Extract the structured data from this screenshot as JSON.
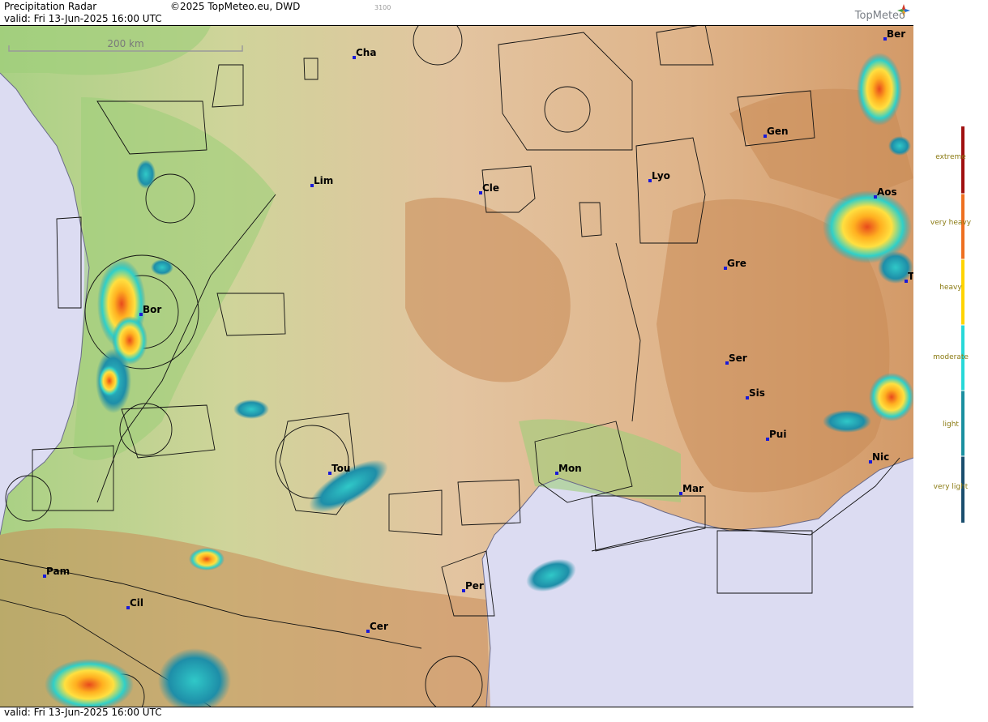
{
  "header": {
    "title": "Precipitation Radar",
    "copyright": "©2025 TopMeteo.eu, DWD",
    "code": "3100",
    "valid": "valid:  Fri  13-Jun-2025 16:00 UTC",
    "logo_text": "TopMeteo"
  },
  "footer": {
    "valid": "valid:  Fri  13-Jun-2025 16:00 UTC"
  },
  "scale_bar": {
    "label": "200 km"
  },
  "cities": [
    {
      "id": "cha",
      "label": "Cha"
    },
    {
      "id": "ber",
      "label": "Ber"
    },
    {
      "id": "gen",
      "label": "Gen"
    },
    {
      "id": "lim",
      "label": "Lim"
    },
    {
      "id": "cle",
      "label": "Cle"
    },
    {
      "id": "lyo",
      "label": "Lyo"
    },
    {
      "id": "aos",
      "label": "Aos"
    },
    {
      "id": "gre",
      "label": "Gre"
    },
    {
      "id": "bor",
      "label": "Bor"
    },
    {
      "id": "ser",
      "label": "Ser"
    },
    {
      "id": "sis",
      "label": "Sis"
    },
    {
      "id": "pui",
      "label": "Pui"
    },
    {
      "id": "nic",
      "label": "Nic"
    },
    {
      "id": "tou",
      "label": "Tou"
    },
    {
      "id": "mon",
      "label": "Mon"
    },
    {
      "id": "mar",
      "label": "Mar"
    },
    {
      "id": "pam",
      "label": "Pam"
    },
    {
      "id": "cil",
      "label": "Cil"
    },
    {
      "id": "per",
      "label": "Per"
    },
    {
      "id": "cer",
      "label": "Cer"
    },
    {
      "id": "tur",
      "label": "T"
    }
  ],
  "legend": {
    "labels": {
      "extreme": "extreme",
      "very_heavy": "very heavy",
      "heavy": "heavy",
      "moderate": "moderate",
      "light": "light",
      "very_light": "very light"
    },
    "colors": [
      "#a01010",
      "#ee7020",
      "#ffd400",
      "#28d8d8",
      "#1a8fa0",
      "#1a4e6e"
    ]
  },
  "colors": {
    "sea": "#dcdcf2",
    "lowland": "#9ecf7a",
    "hills": "#e0b890",
    "mountains": "#c98b55"
  }
}
